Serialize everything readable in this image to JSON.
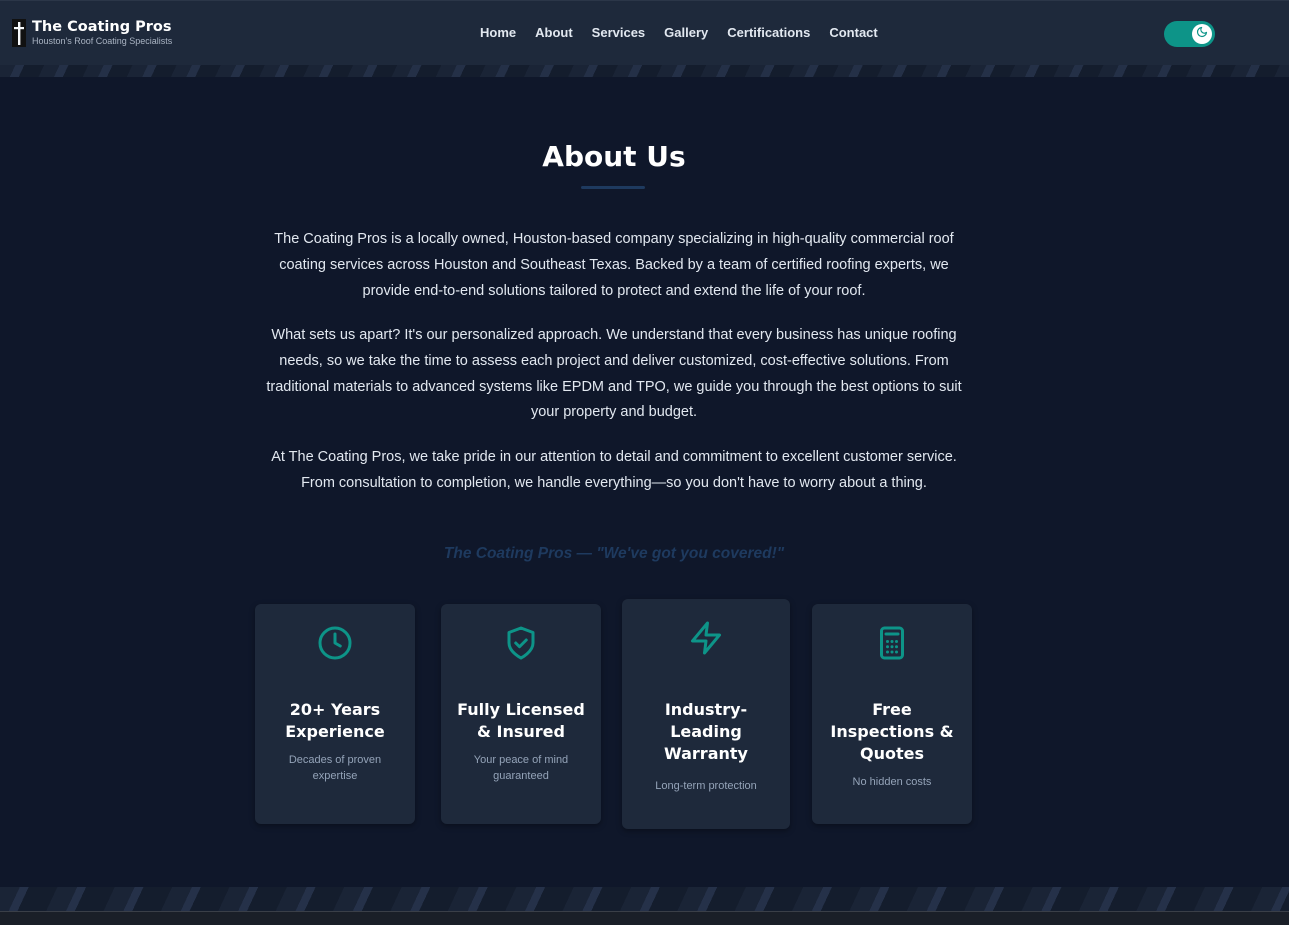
{
  "brand": {
    "name": "The Coating Pros",
    "tagline": "Houston's Roof Coating Specialists"
  },
  "nav": [
    "Home",
    "About",
    "Services",
    "Gallery",
    "Certifications",
    "Contact"
  ],
  "theme_toggle": {
    "state": "dark",
    "icon": "moon-icon"
  },
  "about": {
    "heading": "About Us",
    "paragraphs": [
      "The Coating Pros is a locally owned, Houston-based company specializing in high-quality commercial roof coating services across Houston and Southeast Texas. Backed by a team of certified roofing experts, we provide end-to-end solutions tailored to protect and extend the life of your roof.",
      "What sets us apart? It's our personalized approach. We understand that every business has unique roofing needs, so we take the time to assess each project and deliver customized, cost-effective solutions. From traditional materials to advanced systems like EPDM and TPO, we guide you through the best options to suit your property and budget.",
      "At The Coating Pros, we take pride in our attention to detail and commitment to excellent customer service. From consultation to completion, we handle everything—so you don't have to worry about a thing."
    ],
    "slogan": "The Coating Pros — \"We've got you covered!\""
  },
  "features": [
    {
      "icon": "clock-icon",
      "title": "20+ Years Experience",
      "subtitle": "Decades of proven expertise"
    },
    {
      "icon": "shield-check-icon",
      "title": "Fully Licensed & Insured",
      "subtitle": "Your peace of mind guaranteed"
    },
    {
      "icon": "lightning-icon",
      "title": "Industry-Leading Warranty",
      "subtitle": "Long-term protection"
    },
    {
      "icon": "calculator-icon",
      "title": "Free Inspections & Quotes",
      "subtitle": "No hidden costs"
    }
  ],
  "colors": {
    "accent": "#0d9488",
    "page_bg": "#0f172a",
    "card_bg": "#1e293b",
    "slogan": "#1e3a5f"
  }
}
